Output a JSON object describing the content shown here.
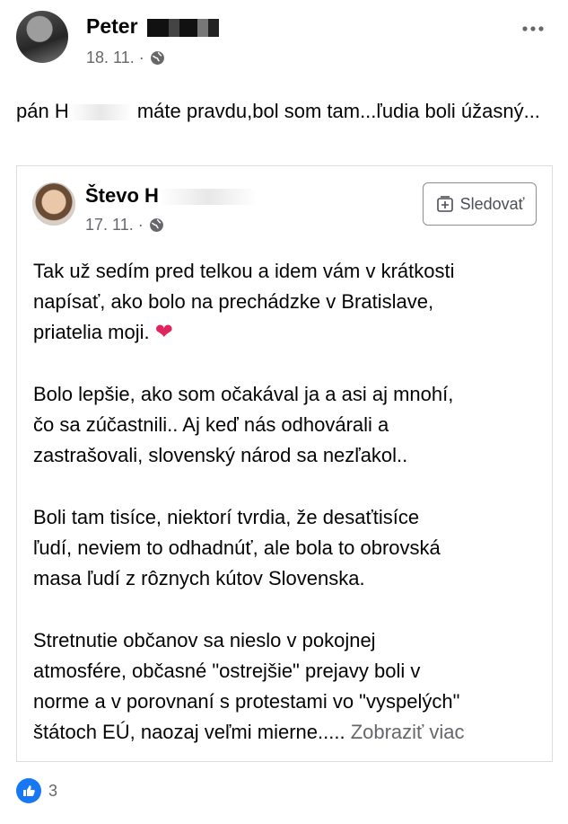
{
  "post": {
    "author": "Peter",
    "date": "18. 11. ·",
    "text_start": "pán H",
    "text_end": "máte pravdu,bol som tam...ľudia boli úžasný..."
  },
  "shared": {
    "author": "Števo H",
    "date": "17. 11. ·",
    "follow_label": "Sledovať",
    "para1": "Tak už sedím pred telkou a idem vám v krátkosti\nnapísať, ako bolo na prechádzke v Bratislave,\npriatelia moji.",
    "heart": "❤",
    "para2": "Bolo lepšie, ako som očakával ja a asi aj mnohí,\nčo sa zúčastnili.. Aj keď nás odhovárali a\nzastrašovali, slovenský národ sa nezľakol..",
    "para3": "Boli tam tisíce, niektorí tvrdia, že desaťtisíce\nľudí, neviem to odhadnúť, ale bola to obrovská\nmasa ľudí z rôznych kútov Slovenska.",
    "para4": "Stretnutie občanov sa nieslo v pokojnej\natmosfére, občasné \"ostrejšie\" prejavy boli v\nnorme a v porovnaní s protestami vo \"vyspelých\"\nštátoch EÚ, naozaj veľmi mierne.....",
    "see_more": "Zobraziť viac"
  },
  "reactions": {
    "count": "3",
    "icon": "like-icon",
    "color": "#1877f2"
  }
}
